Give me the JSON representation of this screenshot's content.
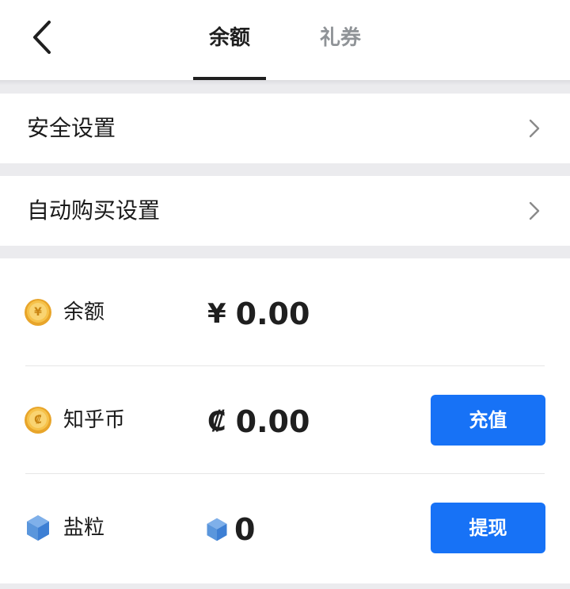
{
  "header": {
    "tabs": [
      {
        "label": "余额",
        "active": true
      },
      {
        "label": "礼券",
        "active": false
      }
    ]
  },
  "settings": {
    "security_label": "安全设置",
    "auto_buy_label": "自动购买设置"
  },
  "assets": {
    "balance": {
      "name": "余额",
      "symbol": "¥",
      "amount": "0.00"
    },
    "zhihu_coin": {
      "name": "知乎币",
      "symbol": "₡",
      "amount": "0.00",
      "action": "充值"
    },
    "salt": {
      "name": "盐粒",
      "amount": "0",
      "action": "提现"
    }
  },
  "colors": {
    "accent": "#1772f6",
    "background": "#ebebee",
    "coin_gold": "#f0b63a",
    "salt_blue": "#3c7fd0"
  }
}
